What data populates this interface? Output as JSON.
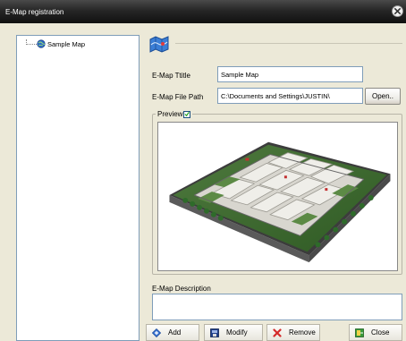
{
  "window": {
    "title": "E-Map registration"
  },
  "tree": {
    "items": [
      {
        "label": "Sample Map"
      }
    ]
  },
  "form": {
    "title_label": "E-Map Ttitle",
    "title_value": "Sample Map",
    "path_label": "E-Map File Path",
    "path_value": "C:\\Documents and Settings\\JUSTIN\\",
    "open_label": "Open..",
    "preview_label": "Preview",
    "preview_checked": true,
    "description_label": "E-Map Description",
    "description_value": ""
  },
  "buttons": {
    "add": "Add",
    "modify": "Modify",
    "remove": "Remove",
    "close": "Close"
  },
  "icons": {
    "window_close": "close-icon",
    "tree_item": "map-icon",
    "header": "map-header-icon",
    "add": "add-icon",
    "modify": "modify-icon",
    "remove": "remove-icon",
    "close": "exit-icon"
  }
}
